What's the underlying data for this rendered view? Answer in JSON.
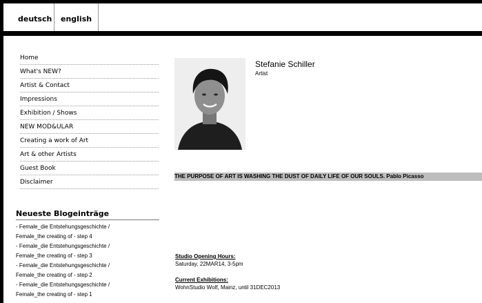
{
  "languages": {
    "german": "deutsch",
    "english": "english"
  },
  "nav": [
    "Home",
    "What's NEW?",
    "Artist & Contact",
    "Impressions",
    "Exhibition / Shows",
    "NEW MOD&ULAR",
    "Creating a work of Art",
    "Art & other Artists",
    "Guest Book",
    "Disclaimer"
  ],
  "blog": {
    "title": "Neueste Blogeinträge",
    "entries": [
      "- Female_die Entstehungsgeschichte /",
      "Female_the creating of - step 4",
      "- Female_die Entstehungsgeschichte /",
      "Female_the creating of - step 3",
      "- Female_die Entstehungsgeschichte /",
      "Female_the creating of - step 2",
      "- Female_die Entstehungsgeschichte /",
      "Female_the creating of - step 1"
    ]
  },
  "artist": {
    "name": "Stefanie Schiller",
    "role": "Artist"
  },
  "quote": "THE PURPOSE OF ART IS WASHING THE DUST OF DAILY LIFE OF OUR SOULS.    Pablo Picasso",
  "studio": {
    "heading": "Studio Opening Hours:",
    "text": "Saturday, 22MAR14, 3-5pm"
  },
  "exhibitions": {
    "heading": "Current Exhibitions:",
    "text": "WohnStudio Wolf, Mainz, until  31DEC2013"
  }
}
